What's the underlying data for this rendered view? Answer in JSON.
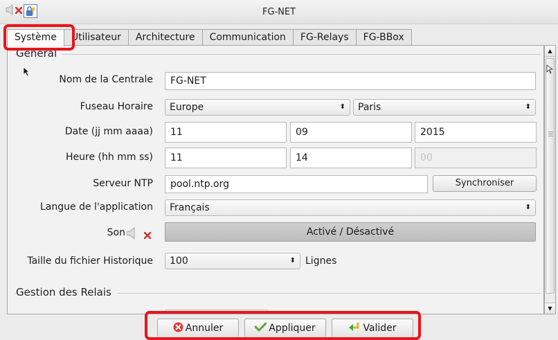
{
  "window": {
    "title": "FG-NET"
  },
  "tabs": [
    {
      "label": "Système",
      "active": true
    },
    {
      "label": "Utilisateur"
    },
    {
      "label": "Architecture"
    },
    {
      "label": "Communication"
    },
    {
      "label": "FG-Relays"
    },
    {
      "label": "FG-BBox"
    }
  ],
  "general": {
    "title": "Général",
    "nom_label": "Nom de la Centrale",
    "nom_value": "FG-NET",
    "fuseau_label": "Fuseau Horaire",
    "fuseau_region": "Europe",
    "fuseau_city": "Paris",
    "date_label": "Date (jj mm aaaa)",
    "date_day": "11",
    "date_month": "09",
    "date_year": "2015",
    "heure_label": "Heure (hh mm ss)",
    "heure_h": "11",
    "heure_m": "14",
    "heure_s": "00",
    "ntp_label": "Serveur NTP",
    "ntp_value": "pool.ntp.org",
    "sync_button": "Synchroniser",
    "langue_label": "Langue de l'application",
    "langue_value": "Français",
    "son_label": "Son",
    "son_toggle": "Activé / Désactivé",
    "taille_label": "Taille du fichier Historique",
    "taille_value": "100",
    "taille_unit": "Lignes"
  },
  "relais": {
    "title": "Gestion des Relais"
  },
  "footer": {
    "annuler": "Annuler",
    "appliquer": "Appliquer",
    "valider": "Valider"
  },
  "colors": {
    "highlight": "#e8161b",
    "accent": "#5f86b6"
  }
}
